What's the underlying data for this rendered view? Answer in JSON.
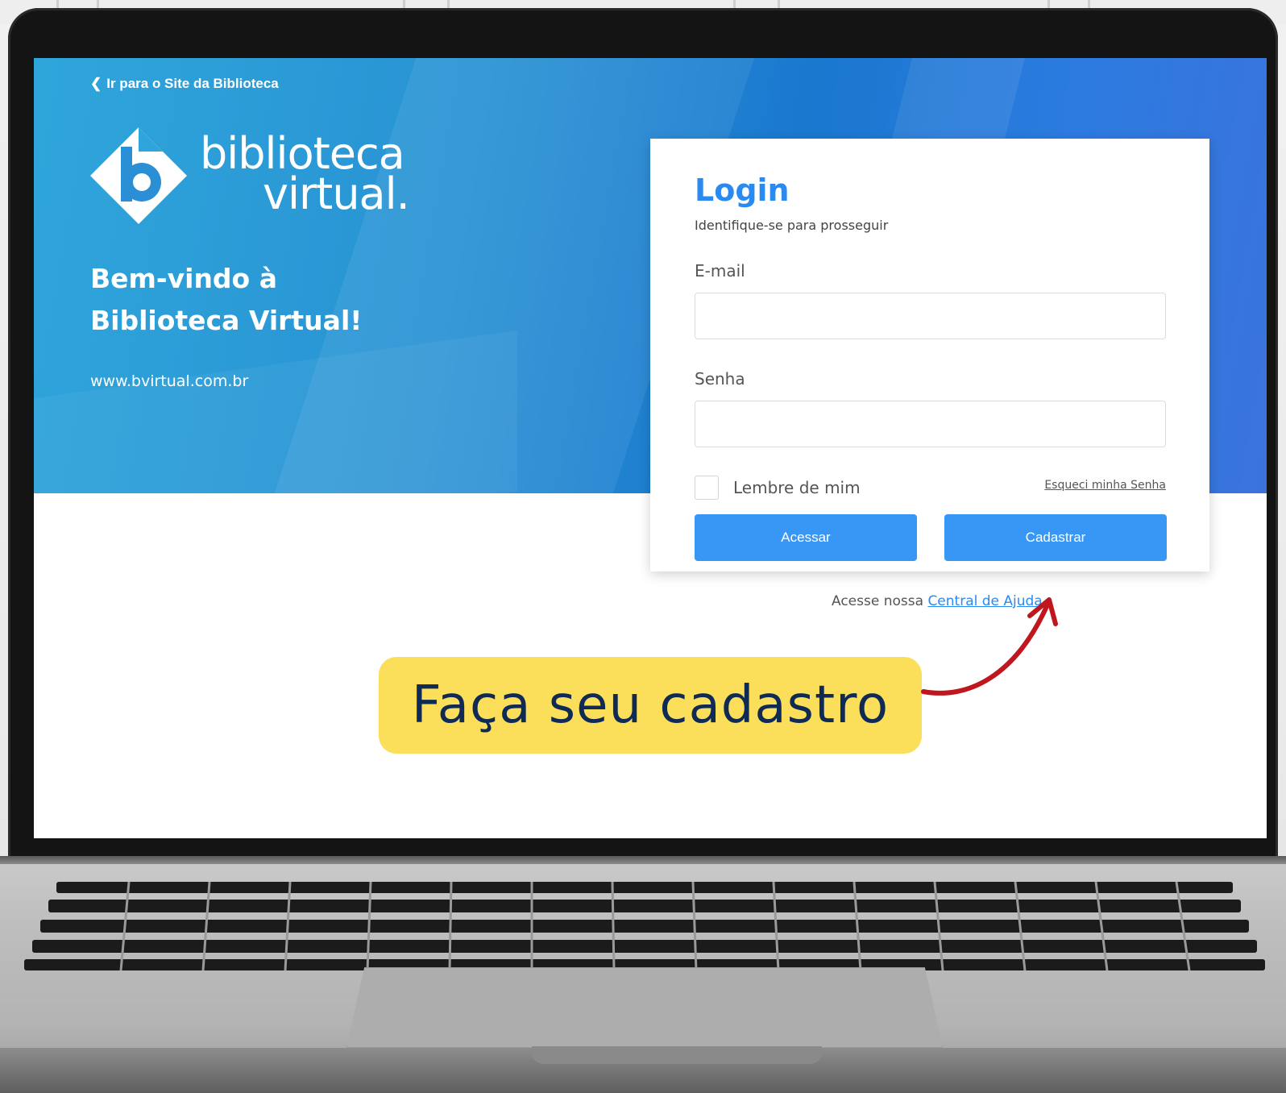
{
  "browser_page": {
    "back_link": "Ir para o Site da Biblioteca",
    "logo": {
      "line1": "biblioteca",
      "line2": "virtual.",
      "mark_letter": "b"
    },
    "welcome_line1": "Bem-vindo à",
    "welcome_line2": "Biblioteca Virtual!",
    "site_url": "www.bvirtual.com.br"
  },
  "login": {
    "title": "Login",
    "subtitle": "Identifique-se para prosseguir",
    "email_label": "E-mail",
    "email_value": "",
    "password_label": "Senha",
    "password_value": "",
    "remember_label": "Lembre de mim",
    "remember_checked": false,
    "forgot_link": "Esqueci minha Senha",
    "enter_button": "Acessar",
    "register_button": "Cadastrar"
  },
  "help": {
    "prefix": "Acesse nossa",
    "link": "Central de Ajuda"
  },
  "annotation": {
    "callout_text": "Faça seu cadastro"
  },
  "colors": {
    "accent_blue": "#3896f4",
    "title_blue": "#2a8af0",
    "hero_blue": "#1a78cf",
    "callout_yellow": "#fbdf5a",
    "callout_text": "#0f2a55",
    "arrow_red": "#c0161d"
  },
  "icons": {
    "back": "chevron-left-icon",
    "logo": "biblioteca-virtual-logo",
    "arrow": "curved-arrow-icon"
  }
}
